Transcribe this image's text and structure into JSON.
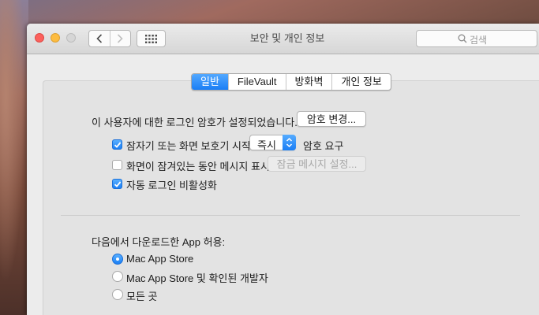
{
  "window": {
    "title": "보안 및 개인 정보"
  },
  "toolbar": {
    "back_icon": "chevron-left-icon",
    "forward_icon": "chevron-right-icon",
    "grid_icon": "grid-icon",
    "search_placeholder": "검색"
  },
  "tabs": [
    {
      "label": "일반",
      "active": true
    },
    {
      "label": "FileVault",
      "active": false
    },
    {
      "label": "방화벽",
      "active": false
    },
    {
      "label": "개인 정보",
      "active": false
    }
  ],
  "general": {
    "password_set_text": "이 사용자에 대한 로그인 암호가 설정되었습니다.",
    "change_password_button": "암호 변경...",
    "require_password": {
      "checked": true,
      "label": "잠자기 또는 화면 보호기 시작",
      "delay_value": "즉시",
      "suffix": "암호 요구"
    },
    "show_message": {
      "checked": false,
      "label": "화면이 잠겨있는 동안 메시지 표시",
      "button": "잠금 메시지 설정..."
    },
    "disable_auto_login": {
      "checked": true,
      "label": "자동 로그인 비활성화"
    }
  },
  "allow_apps": {
    "heading": "다음에서 다운로드한 App 허용:",
    "options": [
      {
        "label": "Mac App Store",
        "selected": true
      },
      {
        "label": "Mac App Store 및 확인된 개발자",
        "selected": false
      },
      {
        "label": "모든 곳",
        "selected": false
      }
    ]
  },
  "colors": {
    "accent": "#1a7ef5",
    "close": "#fc605c",
    "minimize": "#fdbc40"
  }
}
